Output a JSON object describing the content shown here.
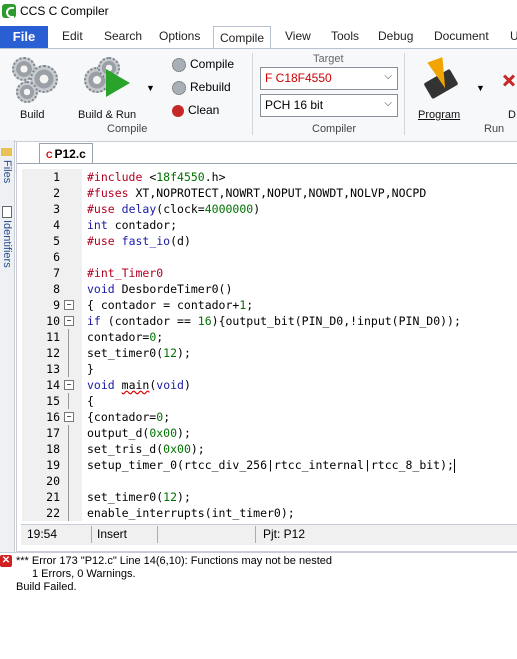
{
  "window": {
    "title": "CCS C Compiler"
  },
  "menu": {
    "file": "File",
    "items": [
      "Edit",
      "Search",
      "Options",
      "Compile",
      "View",
      "Tools",
      "Debug",
      "Document",
      "U"
    ],
    "active": "Compile"
  },
  "ribbon": {
    "build_label": "Build",
    "build_run_label": "Build & Run",
    "compile_label": "Compile",
    "rebuild_label": "Rebuild",
    "clean_label": "Clean",
    "group_compile": "Compile",
    "target_label": "Target",
    "target_value": "F C18F4550",
    "compiler_value": "PCH 16 bit",
    "group_compiler": "Compiler",
    "program_label": "Program",
    "debug_label": "D",
    "group_run": "Run"
  },
  "sidebar": {
    "files_tab": "Files",
    "identifiers_tab": "Identifiers"
  },
  "editor": {
    "file_tab": "P12.c",
    "lines": [
      {
        "n": "1",
        "t": "#include <18f4550.h>"
      },
      {
        "n": "2",
        "t": "#fuses XT,NOPROTECT,NOWRT,NOPUT,NOWDT,NOLVP,NOCPD"
      },
      {
        "n": "3",
        "t": "#use delay(clock=4000000)"
      },
      {
        "n": "4",
        "t": "int contador;"
      },
      {
        "n": "5",
        "t": "#use fast_io(d)"
      },
      {
        "n": "6",
        "t": ""
      },
      {
        "n": "7",
        "t": "#int_Timer0"
      },
      {
        "n": "8",
        "t": "void DesbordeTimer0()"
      },
      {
        "n": "9",
        "t": "{ contador = contador+1;"
      },
      {
        "n": "10",
        "t": "if (contador == 16){output_bit(PIN_D0,!input(PIN_D0));"
      },
      {
        "n": "11",
        "t": "contador=0;"
      },
      {
        "n": "12",
        "t": "set_timer0(12);"
      },
      {
        "n": "13",
        "t": "}"
      },
      {
        "n": "14",
        "t": "void main(void)"
      },
      {
        "n": "15",
        "t": "{"
      },
      {
        "n": "16",
        "t": "{contador=0;"
      },
      {
        "n": "17",
        "t": "output_d(0x00);"
      },
      {
        "n": "18",
        "t": "set_tris_d(0x00);"
      },
      {
        "n": "19",
        "t": "setup_timer_0(rtcc_div_256|rtcc_internal|rtcc_8_bit);"
      },
      {
        "n": "20",
        "t": ""
      },
      {
        "n": "21",
        "t": "set_timer0(12);"
      },
      {
        "n": "22",
        "t": "enable_interrupts(int_timer0);"
      }
    ]
  },
  "status": {
    "position": "19:54",
    "mode": "Insert",
    "project": "Pjt: P12"
  },
  "output": {
    "error": "*** Error 173 \"P12.c\" Line 14(6,10): Functions may not be nested",
    "summary": "1 Errors,  0 Warnings.",
    "result": "Build Failed."
  }
}
